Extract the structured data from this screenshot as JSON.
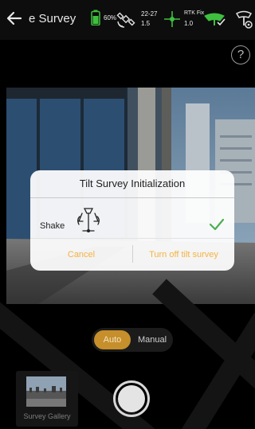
{
  "status_bar": {
    "title": "e Survey",
    "battery": "60%",
    "satellites_top": "22-27",
    "satellites_bottom": "1.5",
    "rtk_status": "RTK Fix",
    "rtk_value": "1.0",
    "icons": [
      "back-arrow-icon",
      "battery-icon",
      "satellite-icon",
      "rtk-antenna-icon",
      "receiver-icon",
      "device-settings-icon"
    ],
    "accent_green": "#3fbf3f"
  },
  "help": {
    "glyph": "?"
  },
  "dialog": {
    "title": "Tilt Survey Initialization",
    "shake_label": "Shake",
    "status_icon": "checkmark-icon",
    "status_color": "#4caf50",
    "cancel_label": "Cancel",
    "turn_off_label": "Turn off tilt survey",
    "action_color": "#f5b342"
  },
  "mode": {
    "auto_label": "Auto",
    "manual_label": "Manual",
    "selected": "Auto",
    "accent": "#c68f2b"
  },
  "gallery": {
    "label": "Survey Gallery"
  }
}
